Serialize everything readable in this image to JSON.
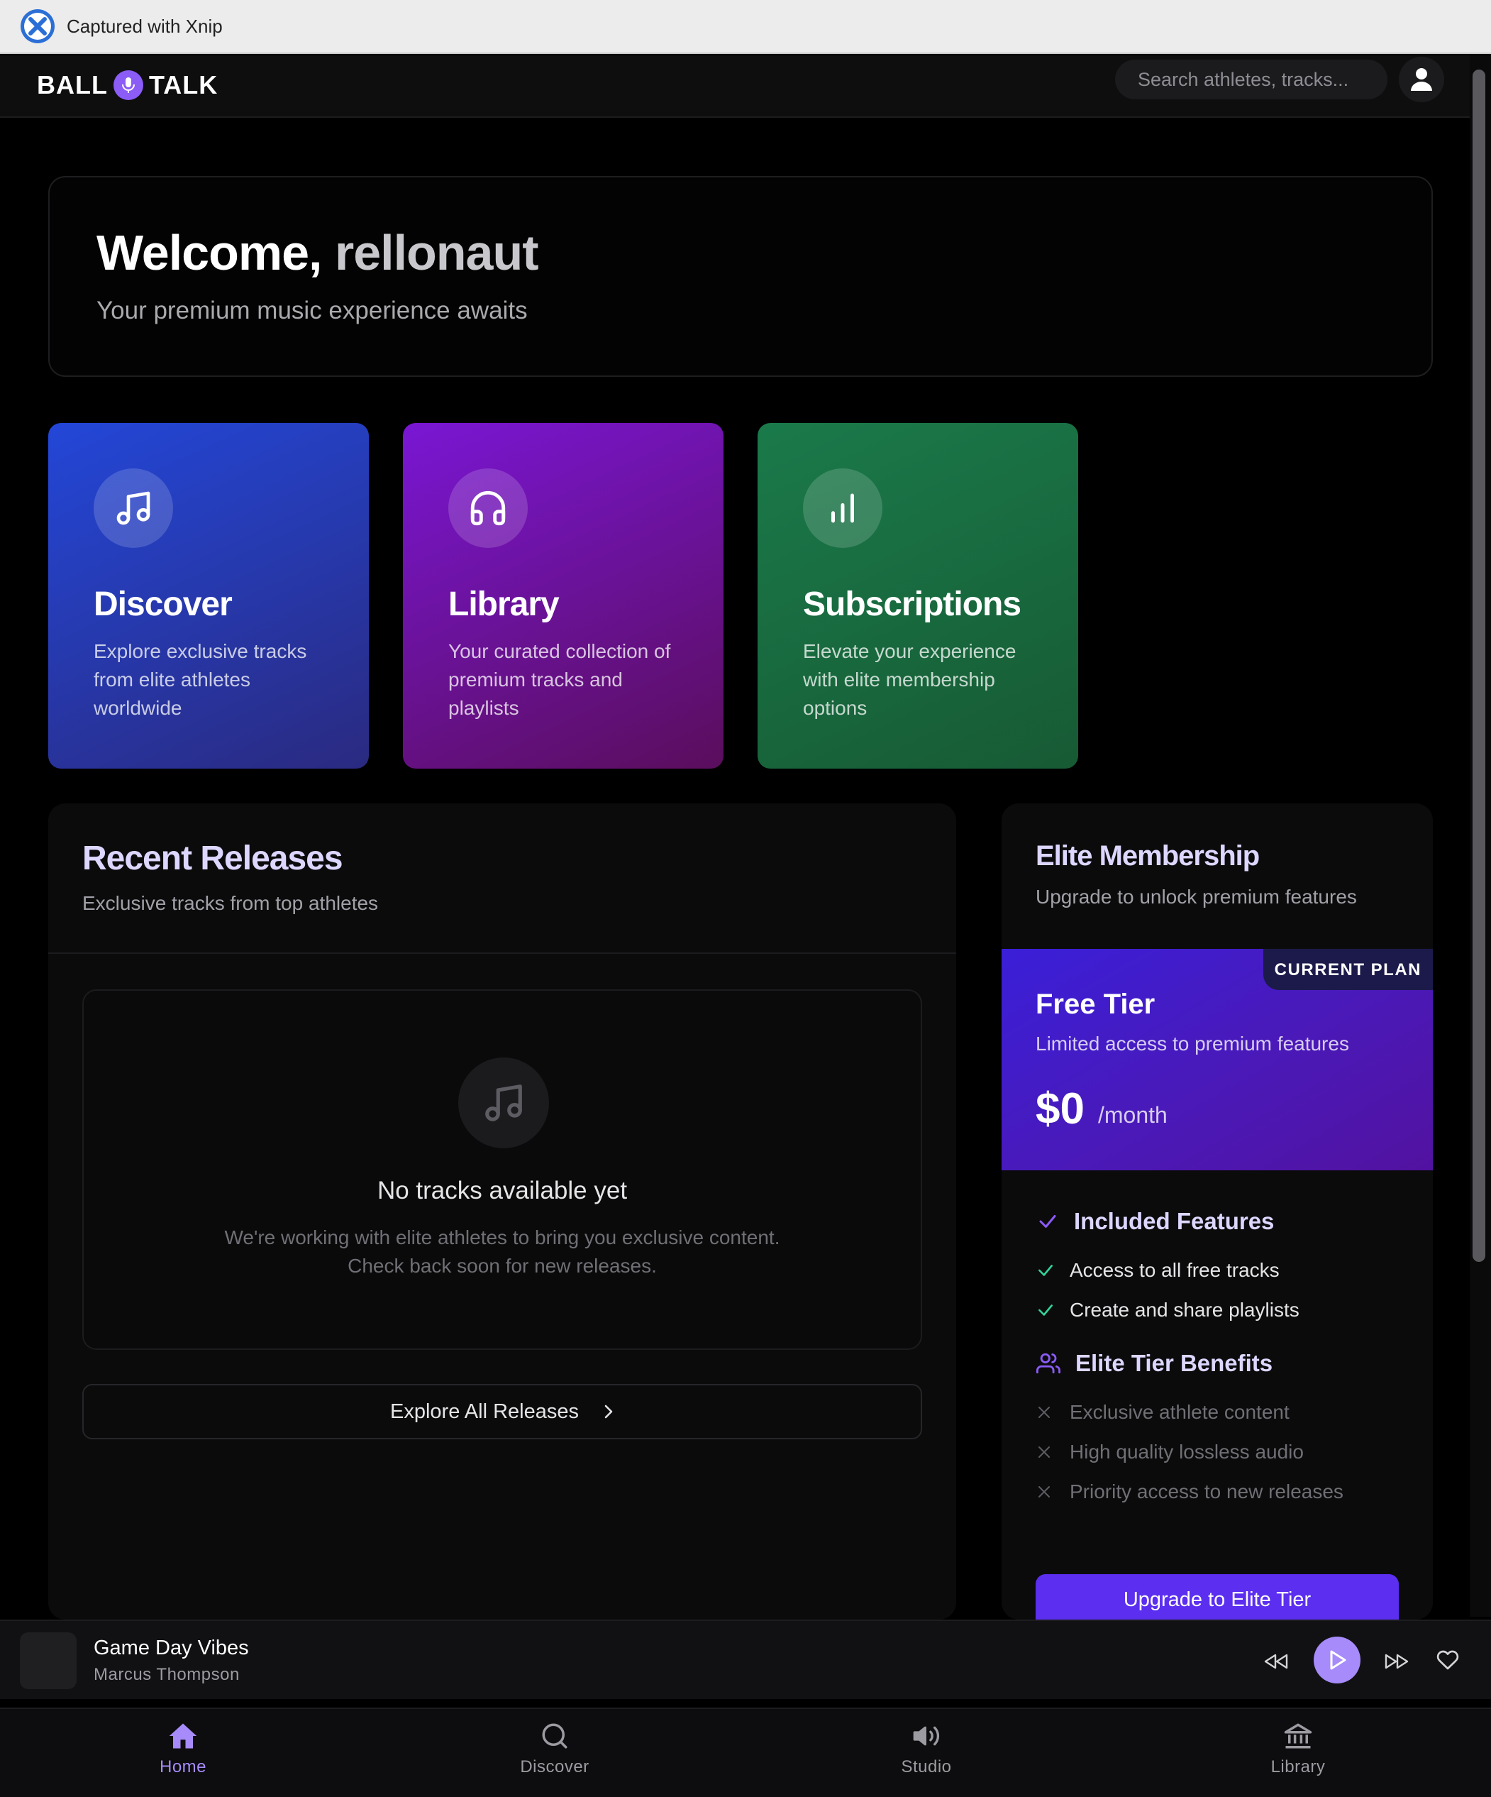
{
  "capture_bar": {
    "text": "Captured with Xnip"
  },
  "header": {
    "brand_left": "BALL",
    "brand_right": "TALK",
    "search_placeholder": "Search athletes, tracks..."
  },
  "welcome": {
    "greeting": "Welcome,",
    "username": "rellonaut",
    "subtitle": "Your premium music experience awaits"
  },
  "feature_cards": [
    {
      "title": "Discover",
      "description": "Explore exclusive tracks from elite athletes worldwide",
      "icon": "music-note-icon"
    },
    {
      "title": "Library",
      "description": "Your curated collection of premium tracks and playlists",
      "icon": "headphones-icon"
    },
    {
      "title": "Subscriptions",
      "description": "Elevate your experience with elite membership options",
      "icon": "bar-chart-icon"
    }
  ],
  "recent_releases": {
    "title": "Recent Releases",
    "subtitle": "Exclusive tracks from top athletes",
    "empty_title": "No tracks available yet",
    "empty_line1": "We're working with elite athletes to bring you exclusive content.",
    "empty_line2": "Check back soon for new releases.",
    "explore_label": "Explore All Releases"
  },
  "membership": {
    "title": "Elite Membership",
    "subtitle": "Upgrade to unlock premium features",
    "plan": {
      "badge": "CURRENT PLAN",
      "name": "Free Tier",
      "description": "Limited access to premium features",
      "price": "$0",
      "period": "/month"
    },
    "included_title": "Included Features",
    "included": [
      "Access to all free tracks",
      "Create and share playlists"
    ],
    "elite_title": "Elite Tier Benefits",
    "elite": [
      "Exclusive athlete content",
      "High quality lossless audio",
      "Priority access to new releases"
    ],
    "upgrade_label": "Upgrade to Elite Tier"
  },
  "player": {
    "song": "Game Day Vibes",
    "artist": "Marcus Thompson"
  },
  "bottom_nav": [
    {
      "label": "Home",
      "icon": "home-icon",
      "active": true
    },
    {
      "label": "Discover",
      "icon": "search-icon",
      "active": false
    },
    {
      "label": "Studio",
      "icon": "speaker-icon",
      "active": false
    },
    {
      "label": "Library",
      "icon": "library-icon",
      "active": false
    }
  ],
  "colors": {
    "accent": "#8b5cf6",
    "accent_light": "#a78bfa",
    "discover_card": "#2347d8",
    "library_card": "#7a16d4",
    "subscriptions_card": "#1a7a4a",
    "check_green": "#34d399"
  }
}
